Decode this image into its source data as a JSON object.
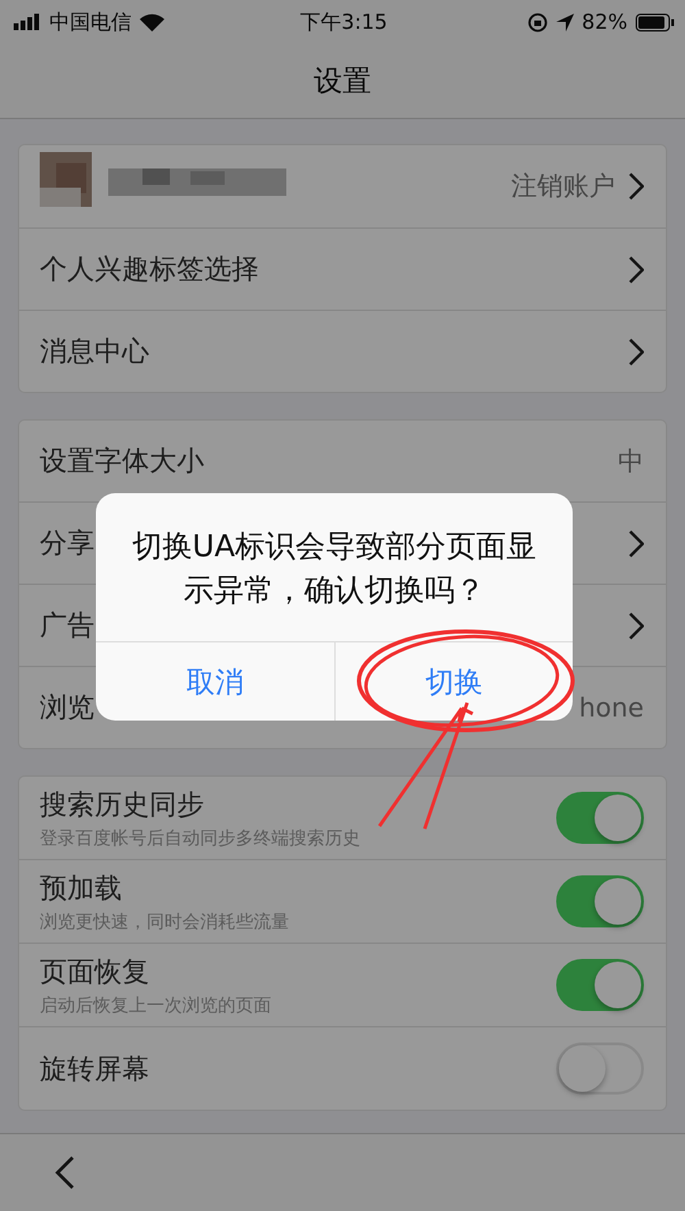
{
  "status_bar": {
    "carrier": "中国电信",
    "time": "下午3:15",
    "battery": "82%"
  },
  "nav": {
    "title": "设置"
  },
  "groups": [
    {
      "rows": [
        {
          "kind": "account",
          "value": "注销账户",
          "chevron": true
        },
        {
          "kind": "link",
          "label": "个人兴趣标签选择",
          "chevron": true
        },
        {
          "kind": "link",
          "label": "消息中心",
          "chevron": true
        }
      ]
    },
    {
      "rows": [
        {
          "kind": "link",
          "label": "设置字体大小",
          "value": "中",
          "chevron": false
        },
        {
          "kind": "link",
          "label": "分享",
          "chevron": true
        },
        {
          "kind": "link",
          "label": "广告",
          "chevron": true
        },
        {
          "kind": "link",
          "label": "浏览",
          "value": "hone",
          "chevron": false
        }
      ]
    },
    {
      "rows": [
        {
          "kind": "toggle",
          "label": "搜索历史同步",
          "sub": "登录百度帐号后自动同步多终端搜索历史",
          "on": true
        },
        {
          "kind": "toggle",
          "label": "预加载",
          "sub": "浏览更快速，同时会消耗些流量",
          "on": true
        },
        {
          "kind": "toggle",
          "label": "页面恢复",
          "sub": "启动后恢复上一次浏览的页面",
          "on": true
        },
        {
          "kind": "toggle",
          "label": "旋转屏幕",
          "on": false
        }
      ]
    }
  ],
  "dialog": {
    "message": "切换UA标识会导致部分页面显示异常，确认切换吗？",
    "buttons": [
      {
        "label": "取消"
      },
      {
        "label": "切换"
      }
    ]
  }
}
